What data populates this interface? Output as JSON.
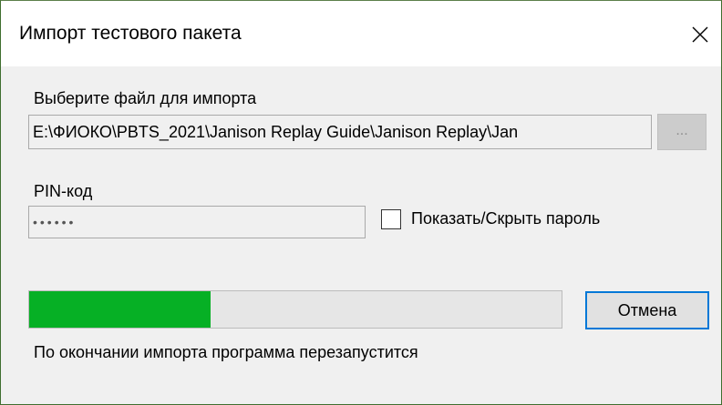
{
  "window": {
    "title": "Импорт тестового пакета",
    "close_glyph": "✕"
  },
  "file_section": {
    "label": "Выберите файл для импорта",
    "path_value": "E:\\ФИОКО\\PBTS_2021\\Janison Replay Guide\\Janison Replay\\Jan",
    "browse_label": "..."
  },
  "pin_section": {
    "label": "PIN-код",
    "value": "••••••",
    "toggle_label": "Показать/Скрыть пароль",
    "toggle_checked": false
  },
  "progress": {
    "value_percent": 34,
    "fill_color": "#06b025"
  },
  "cancel_label": "Отмена",
  "status_text": "По окончании импорта программа перезапустится",
  "colors": {
    "accent": "#0078d7",
    "window_border": "#3f6e2f"
  }
}
